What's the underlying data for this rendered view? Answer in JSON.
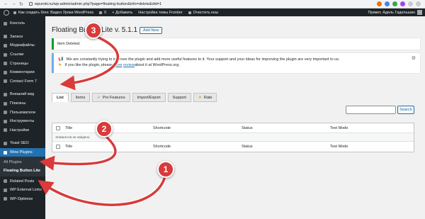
{
  "browser": {
    "url": "wpuroki.ru/wp-admin/admin.php?page=floating-button&info=delete&did=1"
  },
  "adminbar": {
    "site": "Как создать блог. Видео Уроки WordPress",
    "comments": "0",
    "new": "Добавить",
    "theme": "Настройка темы Frontier",
    "cache": "Очистить кеш",
    "greeting": "Привет, Адель Гадельшин"
  },
  "sidebar": {
    "items": [
      {
        "label": "Консоль"
      },
      {
        "label": "Записи"
      },
      {
        "label": "Медиафайлы"
      },
      {
        "label": "Ссылки"
      },
      {
        "label": "Страницы"
      },
      {
        "label": "Комментарии"
      },
      {
        "label": "Contact Form 7"
      },
      {
        "label": "Внешний вид"
      },
      {
        "label": "Плагины"
      },
      {
        "label": "Пользователи"
      },
      {
        "label": "Инструменты"
      },
      {
        "label": "Настройки"
      },
      {
        "label": "Yoast SEO"
      },
      {
        "label": "Wow Plugins"
      },
      {
        "label": "Related Posts"
      },
      {
        "label": "WP External Links"
      },
      {
        "label": "WP-Optimize"
      }
    ],
    "submenu": [
      {
        "label": "All Plugins"
      },
      {
        "label": "Floating Button Lite"
      }
    ]
  },
  "page": {
    "title": "Floating Button Lite v. 5.1.1",
    "add_new": "Add New",
    "notice_deleted": "Item Deleted.",
    "notice_line1": "We are constantly trying to improve the plugin and add more useful features to it. Your support and your ideas for improving the plugin are very important to us.",
    "notice_line2a": "If you like the plugin, please ",
    "notice_link1": "leave",
    "notice_link2": "review",
    "notice_line2b": " about it at WordPress.org."
  },
  "tabs": [
    {
      "label": "List"
    },
    {
      "label": "Items"
    },
    {
      "label": "Pro Features"
    },
    {
      "label": "Import/Export"
    },
    {
      "label": "Support"
    },
    {
      "label": "Rate"
    }
  ],
  "search": {
    "button": "Search"
  },
  "table": {
    "columns": [
      "Title",
      "Shortcode",
      "Status",
      "Test Mode"
    ],
    "empty": "Элементов не найдено."
  },
  "annotations": {
    "n1": "1",
    "n2": "2",
    "n3": "3"
  },
  "colors": {
    "sidebar": "#1d2327",
    "active": "#2271b1",
    "arrow": "#d93a3a"
  }
}
